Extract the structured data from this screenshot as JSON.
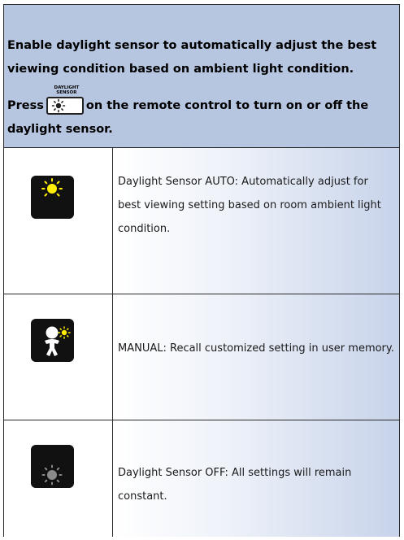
{
  "intro": {
    "text1": "Enable daylight sensor to automatically adjust the best viewing condition based on ambient light condition.",
    "press_label": "Press",
    "button_caption": "DAYLIGHT SENSOR",
    "text2": "on the remote control to turn on or off the daylight sensor."
  },
  "rows": [
    {
      "icon": "sun-moon-auto-icon",
      "description": "Daylight Sensor AUTO: Automatically adjust for best viewing setting based on room ambient light condition."
    },
    {
      "icon": "person-sun-moon-manual-icon",
      "description": "MANUAL: Recall customized setting in user memory."
    },
    {
      "icon": "sun-moon-off-icon",
      "description": "Daylight Sensor OFF: All settings will remain constant."
    }
  ],
  "colors": {
    "intro_bg": "#b6c6e0",
    "icon_yellow": "#ffee00",
    "icon_bg": "#111111",
    "off_gray": "#8a8a8a"
  }
}
